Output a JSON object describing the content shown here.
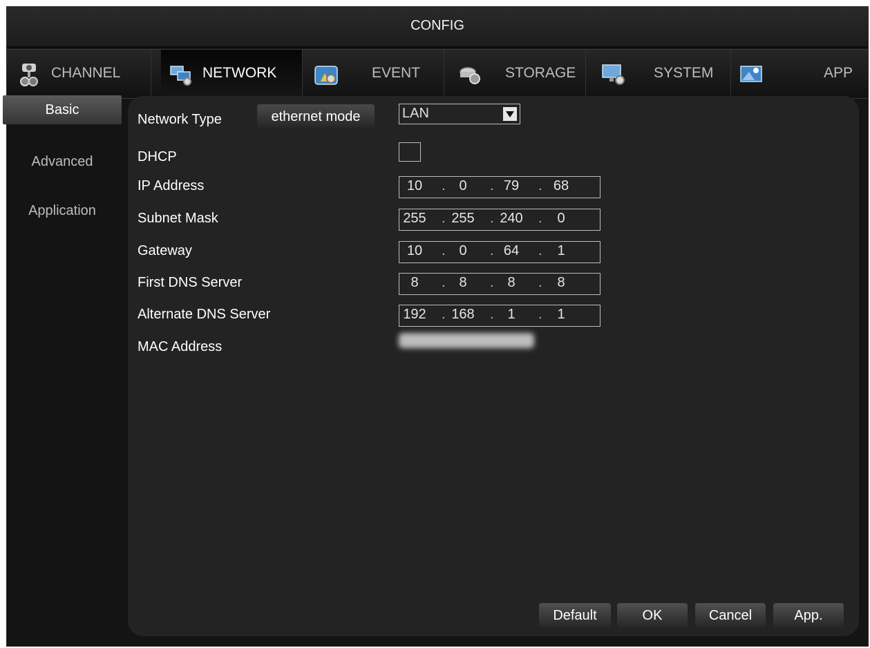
{
  "window": {
    "title": "CONFIG"
  },
  "tabs": [
    {
      "label": "CHANNEL",
      "icon": "camera-icon"
    },
    {
      "label": "NETWORK",
      "icon": "network-icon",
      "active": true
    },
    {
      "label": "EVENT",
      "icon": "event-icon"
    },
    {
      "label": "STORAGE",
      "icon": "storage-icon"
    },
    {
      "label": "SYSTEM",
      "icon": "system-icon"
    },
    {
      "label": "APP",
      "icon": "app-icon"
    }
  ],
  "sidebar": {
    "items": [
      {
        "label": "Basic",
        "active": true
      },
      {
        "label": "Advanced"
      },
      {
        "label": "Application"
      }
    ]
  },
  "form": {
    "network_type": {
      "label": "Network Type",
      "mode_button": "ethernet mode",
      "value": "LAN"
    },
    "dhcp": {
      "label": "DHCP",
      "checked": false
    },
    "ip_address": {
      "label": "IP Address",
      "octets": [
        "10",
        "0",
        "79",
        "68"
      ]
    },
    "subnet_mask": {
      "label": "Subnet Mask",
      "octets": [
        "255",
        "255",
        "240",
        "0"
      ]
    },
    "gateway": {
      "label": "Gateway",
      "octets": [
        "10",
        "0",
        "64",
        "1"
      ]
    },
    "first_dns": {
      "label": "First DNS Server",
      "octets": [
        "8",
        "8",
        "8",
        "8"
      ]
    },
    "alternate_dns": {
      "label": "Alternate DNS Server",
      "octets": [
        "192",
        "168",
        "1",
        "1"
      ]
    },
    "mac_address": {
      "label": "MAC Address"
    }
  },
  "footer": {
    "default_label": "Default",
    "ok_label": "OK",
    "cancel_label": "Cancel",
    "apply_label": "App."
  },
  "colors": {
    "background": "#141414",
    "panel": "#232323",
    "text": "#ffffff",
    "muted_text": "#bdbdbd"
  }
}
